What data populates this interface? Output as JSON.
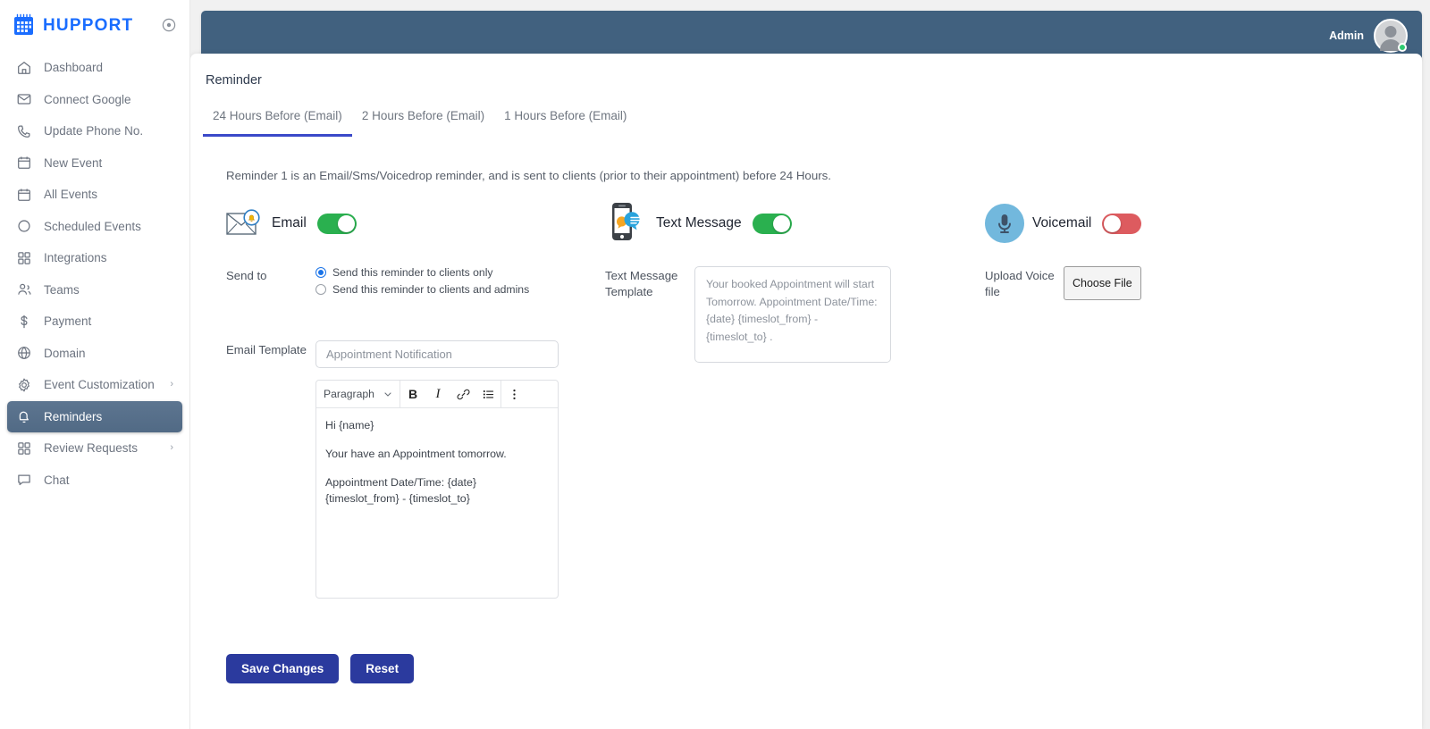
{
  "brand": {
    "name": "HUPPORT",
    "logo_icon": "calendar-grid-icon",
    "collapse_icon": "target-circle-icon",
    "accent": "#1a6dff"
  },
  "sidebar": {
    "items": [
      {
        "label": "Dashboard",
        "icon": "home-icon",
        "active": false,
        "chevron": ""
      },
      {
        "label": "Connect Google",
        "icon": "envelope-icon",
        "active": false,
        "chevron": ""
      },
      {
        "label": "Update Phone No.",
        "icon": "phone-icon",
        "active": false,
        "chevron": ""
      },
      {
        "label": "New Event",
        "icon": "calendar-icon",
        "active": false,
        "chevron": ""
      },
      {
        "label": "All Events",
        "icon": "calendar-icon",
        "active": false,
        "chevron": ""
      },
      {
        "label": "Scheduled Events",
        "icon": "circle-icon",
        "active": false,
        "chevron": ""
      },
      {
        "label": "Integrations",
        "icon": "grid-icon",
        "active": false,
        "chevron": ""
      },
      {
        "label": "Teams",
        "icon": "users-icon",
        "active": false,
        "chevron": ""
      },
      {
        "label": "Payment",
        "icon": "dollar-icon",
        "active": false,
        "chevron": ""
      },
      {
        "label": "Domain",
        "icon": "globe-icon",
        "active": false,
        "chevron": ""
      },
      {
        "label": "Event Customization",
        "icon": "gear-icon",
        "active": false,
        "chevron": "›"
      },
      {
        "label": "Reminders",
        "icon": "bell-icon",
        "active": true,
        "chevron": ""
      },
      {
        "label": "Review Requests",
        "icon": "grid-icon",
        "active": false,
        "chevron": "›"
      },
      {
        "label": "Chat",
        "icon": "chat-icon",
        "active": false,
        "chevron": ""
      }
    ]
  },
  "topbar": {
    "user_label": "Admin",
    "avatar_icon": "user-avatar",
    "status": "online",
    "bg": "#41617f"
  },
  "page": {
    "title": "Reminder",
    "tabs": [
      {
        "label": "24 Hours Before (Email)",
        "active": true
      },
      {
        "label": "2 Hours Before (Email)",
        "active": false
      },
      {
        "label": "1 Hours Before (Email)",
        "active": false
      }
    ],
    "description": "Reminder 1 is an Email/Sms/Voicedrop reminder, and is sent to clients (prior to their appointment) before 24 Hours."
  },
  "channels": {
    "email": {
      "label": "Email",
      "icon": "email-bell-icon",
      "enabled": true,
      "toggle_color": "#2ab04f"
    },
    "text": {
      "label": "Text Message",
      "icon": "sms-phone-icon",
      "enabled": true,
      "toggle_color": "#2ab04f"
    },
    "voicemail": {
      "label": "Voicemail",
      "icon": "microphone-icon",
      "enabled": false,
      "toggle_color": "#dd5b5f"
    }
  },
  "email_section": {
    "send_to_label": "Send to",
    "options": [
      {
        "label": "Send this reminder to clients only",
        "selected": true
      },
      {
        "label": "Send this reminder to clients and admins",
        "selected": false
      }
    ],
    "template_label": "Email Template",
    "subject_value": "Appointment Notification",
    "editor": {
      "block_format": "Paragraph",
      "tools": [
        "bold-icon",
        "italic-icon",
        "link-icon",
        "bullet-list-icon",
        "more-vertical-icon"
      ],
      "bold_label": "B",
      "italic_label": "I",
      "paragraphs": [
        "Hi {name}",
        "Your have an Appointment tomorrow.",
        "Appointment Date/Time: {date} {timeslot_from} - {timeslot_to}"
      ]
    }
  },
  "text_section": {
    "template_label": "Text Message Template",
    "template_value": "Your booked Appointment will start Tomorrow. Appointment Date/Time: {date} {timeslot_from} - {timeslot_to} ."
  },
  "voice_section": {
    "upload_label": "Upload Voice file",
    "choose_file_label": "Choose File"
  },
  "actions": {
    "save_label": "Save Changes",
    "reset_label": "Reset",
    "button_color": "#2b3a9e"
  }
}
